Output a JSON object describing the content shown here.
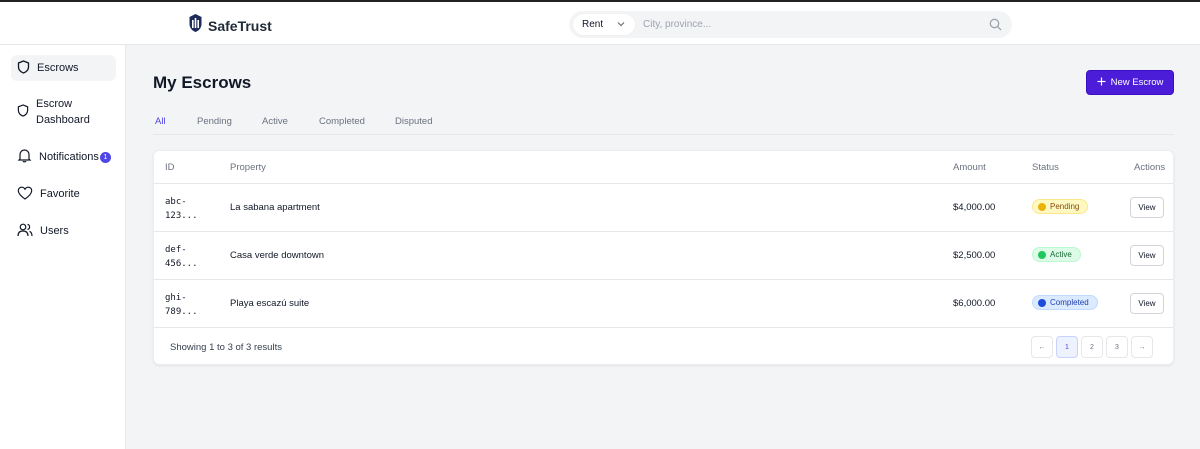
{
  "app": {
    "brand": "SafeTrust"
  },
  "search": {
    "type_value": "Rent",
    "placeholder": "City, province..."
  },
  "sidebar": {
    "items": [
      {
        "label": "Escrows",
        "icon": "shield-icon",
        "active": true
      },
      {
        "label": "Escrow\nDashboard",
        "icon": "shield-icon"
      },
      {
        "label": "Notifications",
        "icon": "bell-icon",
        "badge": "1"
      },
      {
        "label": "Favorite",
        "icon": "heart-icon"
      },
      {
        "label": "Users",
        "icon": "users-icon"
      }
    ]
  },
  "main": {
    "title": "My Escrows",
    "new_button": "New Escrow",
    "tabs": [
      "All",
      "Pending",
      "Active",
      "Completed",
      "Disputed"
    ],
    "active_tab": "All"
  },
  "table": {
    "columns": {
      "id": "ID",
      "property": "Property",
      "amount": "Amount",
      "status": "Status",
      "actions": "Actions"
    },
    "rows": [
      {
        "id_line1": "abc-",
        "id_line2": "123...",
        "property": "La sabana apartment",
        "amount": "$4,000.00",
        "status": "Pending",
        "action": "View"
      },
      {
        "id_line1": "def-",
        "id_line2": "456...",
        "property": "Casa verde downtown",
        "amount": "$2,500.00",
        "status": "Active",
        "action": "View"
      },
      {
        "id_line1": "ghi-",
        "id_line2": "789...",
        "property": "Playa escazú suite",
        "amount": "$6,000.00",
        "status": "Completed",
        "action": "View"
      }
    ],
    "footer_text": "Showing 1 to 3 of 3 results",
    "pagination": {
      "prev": "←",
      "pages": [
        "1",
        "2",
        "3"
      ],
      "current": "1",
      "next": "→"
    }
  },
  "colors": {
    "accent": "#4c1dd9",
    "pending_bg": "#fef9c3",
    "pending_dot": "#eab308",
    "pending_text": "#854d0e",
    "active_bg": "#dcfce7",
    "active_dot": "#22c55e",
    "active_text": "#166534",
    "completed_bg": "#dbeafe",
    "completed_dot": "#1d4ed8",
    "completed_text": "#1e40af"
  }
}
